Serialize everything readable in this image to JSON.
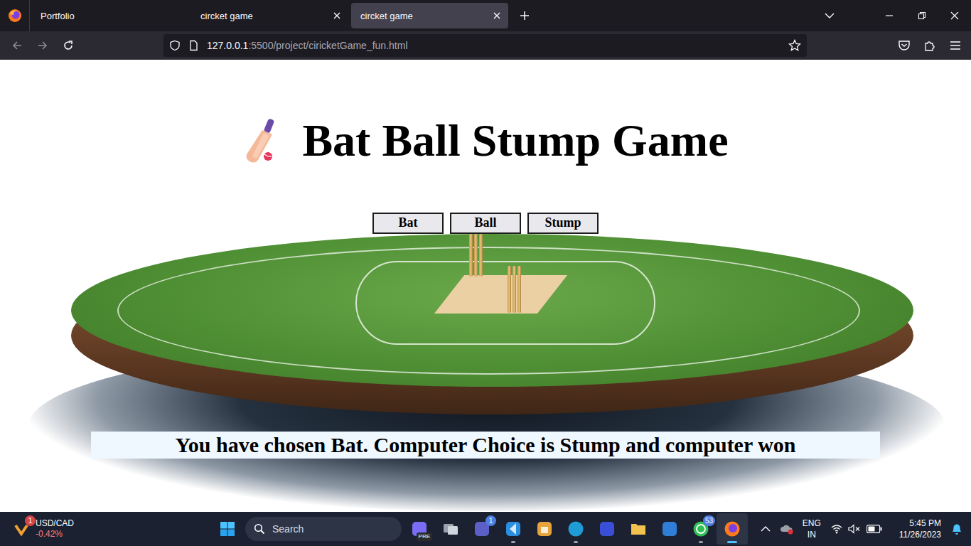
{
  "browser": {
    "tabs": [
      {
        "label": "Portfolio",
        "selected": false,
        "closable": false
      },
      {
        "label": "circket game",
        "selected": false,
        "closable": true
      },
      {
        "label": "circket game",
        "selected": true,
        "closable": true
      }
    ],
    "url_host": "127.0.0.1",
    "url_rest": ":5500/project/ciricketGame_fun.html"
  },
  "page": {
    "title": "Bat Ball Stump Game",
    "buttons": [
      "Bat",
      "Ball",
      "Stump"
    ],
    "result": "You have chosen Bat. Computer Choice is Stump and computer won"
  },
  "taskbar": {
    "widget": {
      "label": "USD/CAD",
      "change": "-0.42%",
      "badge": "1"
    },
    "search_placeholder": "Search",
    "apps": [
      {
        "kind": "copilot",
        "badge": "PRE",
        "running": false,
        "active": false
      },
      {
        "kind": "taskview",
        "badge": "",
        "running": false,
        "active": false
      },
      {
        "kind": "teams",
        "badge": "1",
        "running": false,
        "active": false
      },
      {
        "kind": "vscode",
        "badge": "",
        "running": true,
        "active": false
      },
      {
        "kind": "store",
        "badge": "",
        "running": false,
        "active": false
      },
      {
        "kind": "edge",
        "badge": "",
        "running": true,
        "active": false
      },
      {
        "kind": "mathpix",
        "badge": "",
        "running": false,
        "active": false
      },
      {
        "kind": "files",
        "badge": "",
        "running": false,
        "active": false
      },
      {
        "kind": "remote",
        "badge": "",
        "running": false,
        "active": false
      },
      {
        "kind": "whatsapp",
        "badge": "53",
        "running": true,
        "active": false
      },
      {
        "kind": "firefox",
        "badge": "",
        "running": true,
        "active": true
      }
    ],
    "language": [
      "ENG",
      "IN"
    ],
    "time": "5:45 PM",
    "date": "11/26/2023"
  }
}
